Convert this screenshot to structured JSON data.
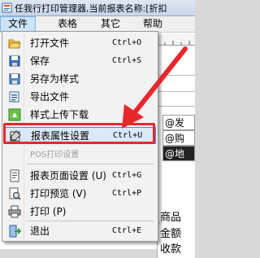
{
  "window": {
    "title": "任我行打印管理器,当前报表名称:[折扣"
  },
  "menubar": {
    "items": [
      {
        "label": "文件"
      },
      {
        "label": "表格"
      },
      {
        "label": "其它"
      },
      {
        "label": "帮助"
      }
    ]
  },
  "file_menu": {
    "items": [
      {
        "label": "打开文件",
        "shortcut": "Ctrl+O",
        "icon": "folder-open-icon"
      },
      {
        "label": "保存",
        "shortcut": "Ctrl+S",
        "icon": "save-icon"
      },
      {
        "label": "另存为样式",
        "shortcut": "",
        "icon": "save-as-icon"
      },
      {
        "label": "导出文件",
        "shortcut": "",
        "icon": "export-icon"
      },
      {
        "label": "样式上传下载",
        "shortcut": "",
        "icon": "upload-download-icon"
      },
      {
        "label": "报表属性设置",
        "shortcut": "Ctrl+U",
        "icon": "report-properties-icon"
      },
      {
        "label": "POS打印设置",
        "shortcut": "",
        "icon": ""
      },
      {
        "label": "报表页面设置 (U)",
        "shortcut": "Ctrl+G",
        "icon": "page-setup-icon"
      },
      {
        "label": "打印预览 (V)",
        "shortcut": "Ctrl+P",
        "icon": "print-preview-icon"
      },
      {
        "label": "打印 (P)",
        "shortcut": "",
        "icon": "print-icon"
      },
      {
        "label": "退出",
        "shortcut": "Ctrl+E",
        "icon": "exit-icon"
      }
    ]
  },
  "background": {
    "cells": [
      "@发",
      "@购",
      "@地"
    ],
    "bottom": [
      "商品",
      "金额",
      "收款"
    ]
  },
  "colors": {
    "highlight_box": "#e8272c",
    "menu_highlight": "#d9e9f9"
  }
}
